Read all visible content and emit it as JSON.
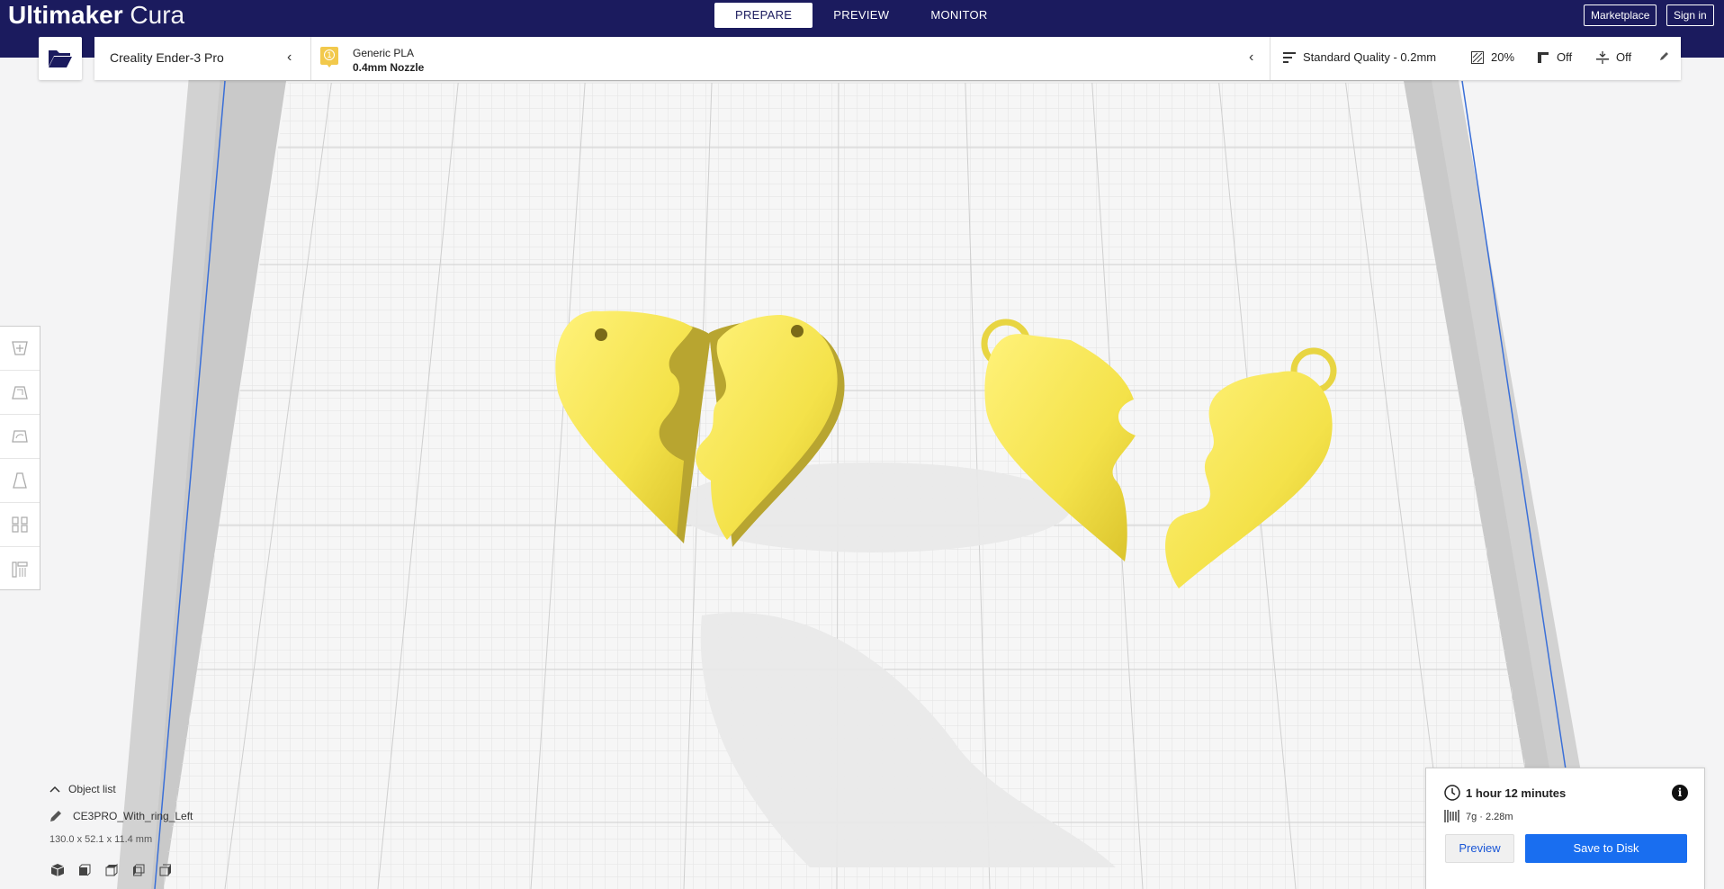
{
  "app": {
    "logo_brand": "Ultimaker",
    "logo_product": "Cura"
  },
  "header": {
    "tabs": [
      {
        "label": "PREPARE",
        "active": true
      },
      {
        "label": "PREVIEW",
        "active": false
      },
      {
        "label": "MONITOR",
        "active": false
      }
    ],
    "marketplace_label": "Marketplace",
    "signin_label": "Sign in",
    "colors": {
      "header_bg": "#1b1b5e"
    }
  },
  "toolbar": {
    "open_icon": "folder-open-icon",
    "printer": "Creality Ender-3 Pro",
    "extruder_number": "1",
    "material": "Generic PLA",
    "nozzle": "0.4mm Nozzle",
    "profile": "Standard Quality - 0.2mm",
    "infill": "20%",
    "support": "Off",
    "adhesion": "Off"
  },
  "tools": [
    {
      "name": "move-tool",
      "icon": "move-icon"
    },
    {
      "name": "scale-tool",
      "icon": "scale-icon"
    },
    {
      "name": "rotate-tool",
      "icon": "rotate-icon"
    },
    {
      "name": "mirror-tool",
      "icon": "mirror-icon"
    },
    {
      "name": "per-model-settings-tool",
      "icon": "per-model-settings-icon"
    },
    {
      "name": "support-blocker-tool",
      "icon": "support-blocker-icon"
    }
  ],
  "object_list": {
    "toggle_label": "Object list",
    "object_name": "CE3PRO_With_ring_Left",
    "dimensions": "130.0 x 52.1 x 11.4 mm",
    "view_buttons": [
      "3d-view",
      "front-view",
      "top-view",
      "left-view",
      "right-view"
    ]
  },
  "print_panel": {
    "time": "1 hour 12 minutes",
    "usage": "7g · 2.28m",
    "preview_label": "Preview",
    "save_label": "Save to Disk",
    "colors": {
      "accent": "#196ef0"
    }
  },
  "scene": {
    "model_color": "#f4e24a",
    "models": [
      "heart-keychain-left",
      "heart-keychain-right",
      "heart-ring-left",
      "heart-ring-right"
    ]
  }
}
